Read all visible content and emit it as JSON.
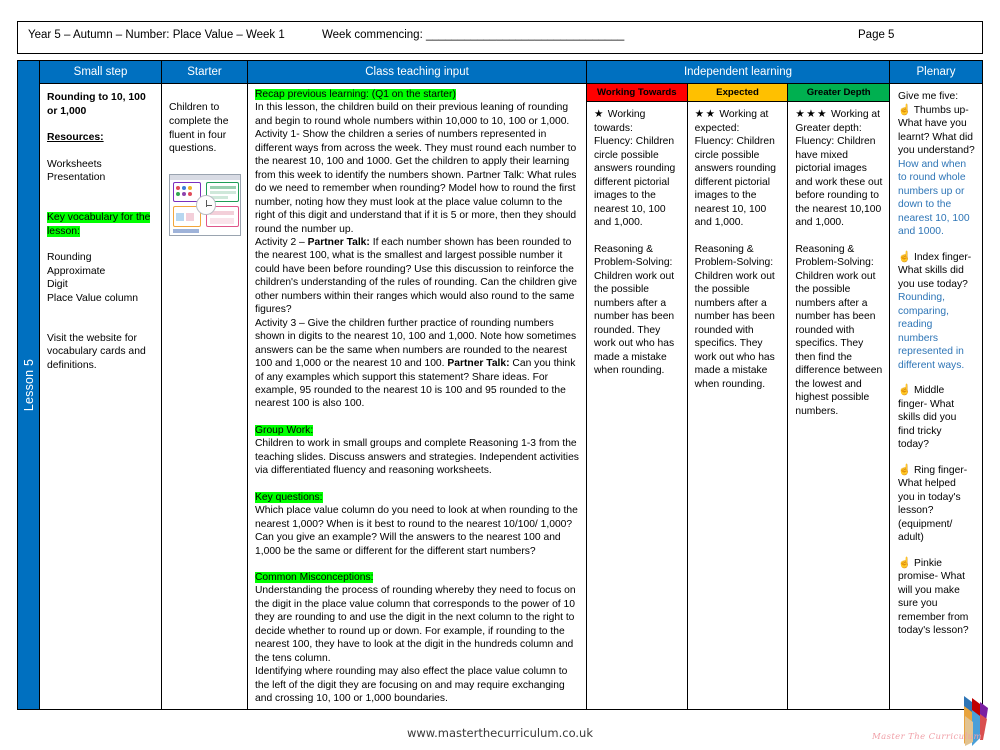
{
  "header": {
    "title": "Year 5 – Autumn – Number: Place Value – Week 1",
    "week_commencing": "Week commencing: _______________________________",
    "page": "Page 5"
  },
  "spine": {
    "label": "Lesson 5"
  },
  "columns": {
    "small_step": "Small step",
    "starter": "Starter",
    "class_teaching_input": "Class teaching input",
    "independent_learning": "Independent learning",
    "plenary": "Plenary"
  },
  "small_step": {
    "title": "Rounding to 10, 100 or 1,000",
    "resources_label": "Resources:",
    "resources": "Worksheets\nPresentation",
    "key_vocab_label": "Key vocabulary for the lesson:",
    "vocab": "Rounding\nApproximate\nDigit\nPlace Value column",
    "note": "Visit the website for vocabulary cards and definitions."
  },
  "starter": {
    "text": "Children to complete the fluent in four questions.",
    "thumbnail_alt": "fluent-in-four-slide-thumbnail"
  },
  "teaching": {
    "recap_label": "Recap previous learning: (Q1 on the starter)",
    "recap_body": "In this lesson, the children build on their previous leaning of rounding and begin to round whole numbers within 10,000 to 10, 100 or 1,000.",
    "activity1": "Activity  1- Show the children a series of numbers represented in different ways from across the week. They must round each number to the nearest 10, 100 and 1000. Get the children to apply their learning from this week to identify the numbers shown. Partner Talk: What rules do we need to remember when rounding? Model how to round the first number, noting how they must look at the place value column to the right of this digit and understand that if it is 5 or more, then they should round the number up.",
    "activity2_pre": "Activity 2 – ",
    "activity2_bold": "Partner Talk:",
    "activity2_body": " If each number shown has been rounded to the nearest 100, what is the smallest and largest possible number it could have been before rounding? Use this discussion to reinforce the children's understanding of the rules of rounding.  Can the children give other numbers within their ranges which would also round to the same figures?",
    "activity3_pre": "Activity 3 – Give the children further practice of rounding numbers shown in digits to the nearest 10, 100 and 1,000. Note how sometimes answers can be the same when numbers are rounded to the nearest 100 and 1,000 or the nearest 10 and 100. ",
    "activity3_bold": "Partner Talk:",
    "activity3_body": " Can you think of any examples which support this statement? Share ideas. For example, 95 rounded to the nearest 10 is 100 and 95 rounded to the nearest 100 is also 100.",
    "group_work_label": "Group Work:",
    "group_work_body": "Children to work in small groups and complete Reasoning 1-3 from the teaching slides. Discuss answers and strategies. Independent activities via differentiated fluency and reasoning worksheets.",
    "key_questions_label": "Key questions:",
    "key_questions_body": "Which place value column do you need to look at when rounding to the nearest 1,000? When is it best to round to the nearest 10/100/ 1,000? Can you give an example? Will the answers to the nearest 100 and 1,000 be the same or different for the different start numbers?",
    "misconceptions_label": "Common Misconceptions:",
    "misconceptions_body1": "Understanding the process of rounding whereby they need to focus on the digit in the place value column that corresponds to the power of 10 they are rounding to and use the digit in the next column to the right to decide whether to round up or down. For example, if rounding to the nearest 100, they have to look at the digit in the hundreds column and the tens column.",
    "misconceptions_body2": "Identifying where rounding may also effect the place value column to the left of the digit they are focusing on and may require exchanging and crossing 10, 100 or 1,000 boundaries."
  },
  "independent": [
    {
      "band": "Working Towards",
      "band_color": "#FF0000",
      "band_text_color": "#000000",
      "stars": "★",
      "title": "Working towards:",
      "fluency": "Fluency: Children circle possible answers rounding different pictorial images to the nearest 10, 100 and 1,000.",
      "reasoning": "Reasoning & Problem-Solving: Children work out the possible numbers after a number has been rounded. They work out who has made a mistake when rounding."
    },
    {
      "band": "Expected",
      "band_color": "#FFC000",
      "band_text_color": "#000000",
      "stars": "★★",
      "title": "Working at expected:",
      "fluency": "Fluency: Children circle possible answers rounding different pictorial images to the nearest 10, 100 and 1,000.",
      "reasoning": "Reasoning & Problem-Solving: Children work out the possible numbers after a number has been rounded with specifics. They work out who has made a mistake when rounding."
    },
    {
      "band": "Greater Depth",
      "band_color": "#00B050",
      "band_text_color": "#000000",
      "stars": "★★★",
      "title": "Working at Greater depth:",
      "fluency": "Fluency: Children have mixed pictorial images and work these out before rounding to the nearest 10,100 and 1,000.",
      "reasoning": "Reasoning & Problem-Solving: Children work out the possible numbers after a number has been rounded with specifics. They then find the difference between the lowest and highest possible numbers."
    }
  ],
  "plenary": {
    "intro": "Give me five:",
    "items": [
      {
        "icon": "hand-icon",
        "glyph": "☝",
        "question": "Thumbs up- What have you learnt? What did you understand?",
        "answer": "How and when to round whole numbers up or down to the nearest 10, 100 and 1000."
      },
      {
        "icon": "hand-icon",
        "glyph": "☝",
        "question": "Index finger- What skills did you use today?",
        "answer": "Rounding, comparing, reading numbers represented in different ways."
      },
      {
        "icon": "hand-icon",
        "glyph": "☝",
        "question": "Middle finger- What skills did you find tricky today?",
        "answer": ""
      },
      {
        "icon": "hand-icon",
        "glyph": "☝",
        "question": "Ring finger- What helped you in today's lesson? (equipment/ adult)",
        "answer": ""
      },
      {
        "icon": "hand-icon",
        "glyph": "☝",
        "question": "Pinkie promise- What will you make sure you remember from today's lesson?",
        "answer": ""
      }
    ],
    "answer_color": "#2E75B6"
  },
  "footer": {
    "url": "www.masterthecurriculum.co.uk",
    "logo_tagline": "Master The Curriculum",
    "logo_alt": "pencil-logo"
  },
  "theme": {
    "header_blue": "#0070C0",
    "highlight_green": "#00FF00"
  }
}
